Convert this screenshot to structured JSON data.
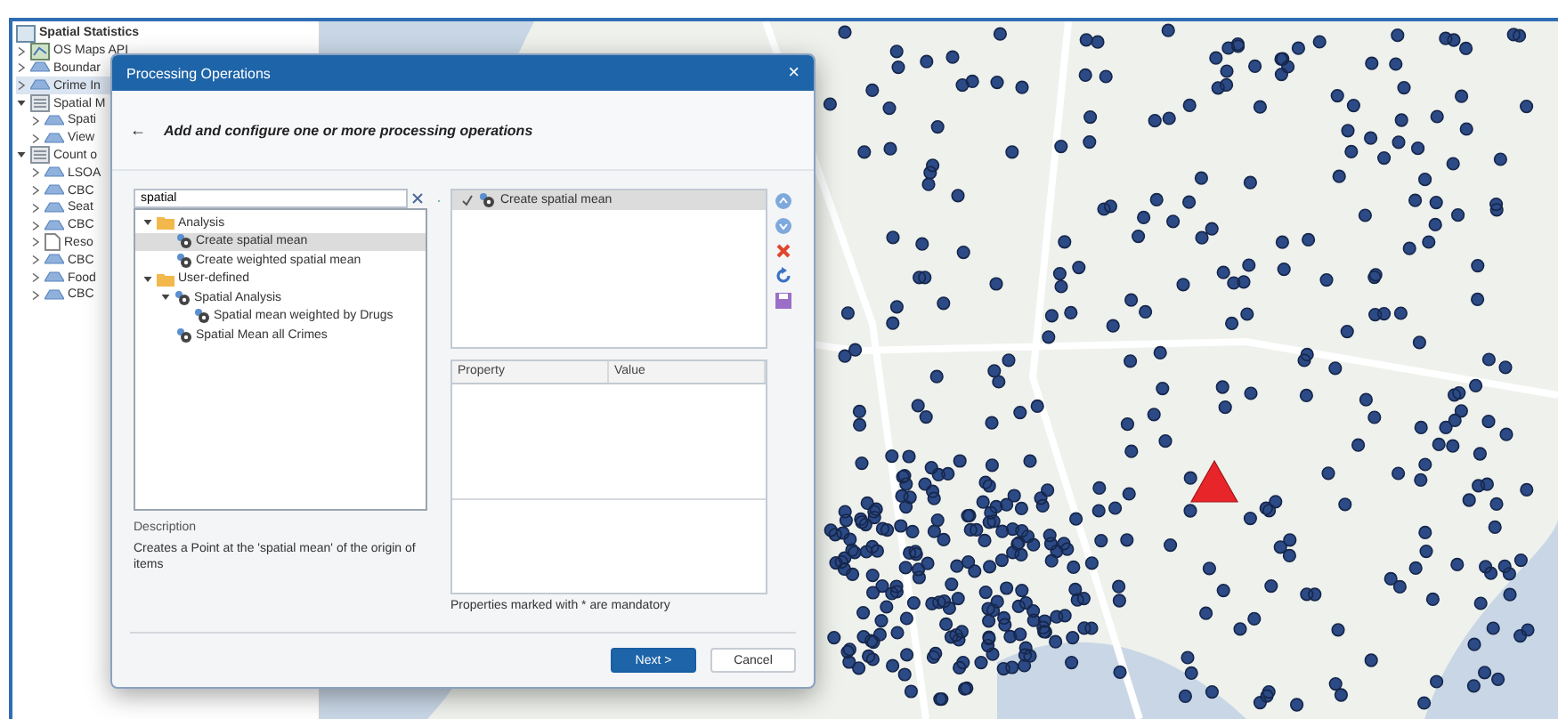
{
  "layer_panel": {
    "title": "Spatial Statistics",
    "items": [
      {
        "label": "OS Maps API",
        "kind": "map",
        "expanded": false,
        "selected": false
      },
      {
        "label": "Boundar",
        "kind": "layer",
        "expanded": false,
        "selected": false
      },
      {
        "label": "Crime In",
        "kind": "layer",
        "expanded": false,
        "selected": true
      },
      {
        "label": "Spatial M",
        "kind": "group",
        "expanded": true,
        "selected": false,
        "children": [
          {
            "label": "Spati",
            "kind": "layer",
            "expanded": false,
            "selected": false
          },
          {
            "label": "View",
            "kind": "layer",
            "expanded": false,
            "selected": false
          }
        ]
      },
      {
        "label": "Count o",
        "kind": "group",
        "expanded": true,
        "selected": false,
        "children": [
          {
            "label": "LSOA",
            "kind": "layer",
            "expanded": false,
            "selected": false
          },
          {
            "label": "CBC",
            "kind": "layer",
            "expanded": false,
            "selected": false
          },
          {
            "label": "Seat",
            "kind": "layer",
            "expanded": false,
            "selected": false
          },
          {
            "label": "CBC",
            "kind": "layer",
            "expanded": false,
            "selected": false
          },
          {
            "label": "Reso",
            "kind": "doc",
            "expanded": false,
            "selected": false
          },
          {
            "label": "CBC",
            "kind": "layer",
            "expanded": false,
            "selected": false
          },
          {
            "label": "Food",
            "kind": "layer",
            "expanded": false,
            "selected": false
          },
          {
            "label": "CBC",
            "kind": "layer",
            "expanded": false,
            "selected": false
          }
        ]
      }
    ]
  },
  "dialog": {
    "title": "Processing Operations",
    "close": "×",
    "back": "←",
    "heading": "Add and configure one or more processing operations",
    "search": {
      "value": "spatial"
    },
    "operations_tree": [
      {
        "label": "Analysis",
        "kind": "folder",
        "expanded": true,
        "selected": false,
        "children": [
          {
            "label": "Create spatial mean",
            "kind": "operation",
            "selected": true
          },
          {
            "label": "Create weighted spatial mean",
            "kind": "operation",
            "selected": false
          }
        ]
      },
      {
        "label": "User-defined",
        "kind": "folder",
        "expanded": true,
        "selected": false,
        "children": [
          {
            "label": "Spatial Analysis",
            "kind": "operation",
            "expanded": true,
            "selected": false,
            "children": [
              {
                "label": "Spatial mean weighted by Drugs",
                "kind": "operation",
                "selected": false
              }
            ]
          },
          {
            "label": "Spatial Mean all Crimes",
            "kind": "operation",
            "selected": false
          }
        ]
      }
    ],
    "description": {
      "label": "Description",
      "text": "Creates a Point at the 'spatial mean' of the origin of items"
    },
    "selected_operations": [
      {
        "label": "Create spatial mean",
        "checked": true,
        "selected": true
      }
    ],
    "properties": {
      "columns": [
        "Property",
        "Value"
      ]
    },
    "note": "Properties marked with * are mandatory",
    "buttons": [
      {
        "label": "Next >",
        "primary": true
      },
      {
        "label": "Cancel",
        "primary": false
      }
    ]
  }
}
